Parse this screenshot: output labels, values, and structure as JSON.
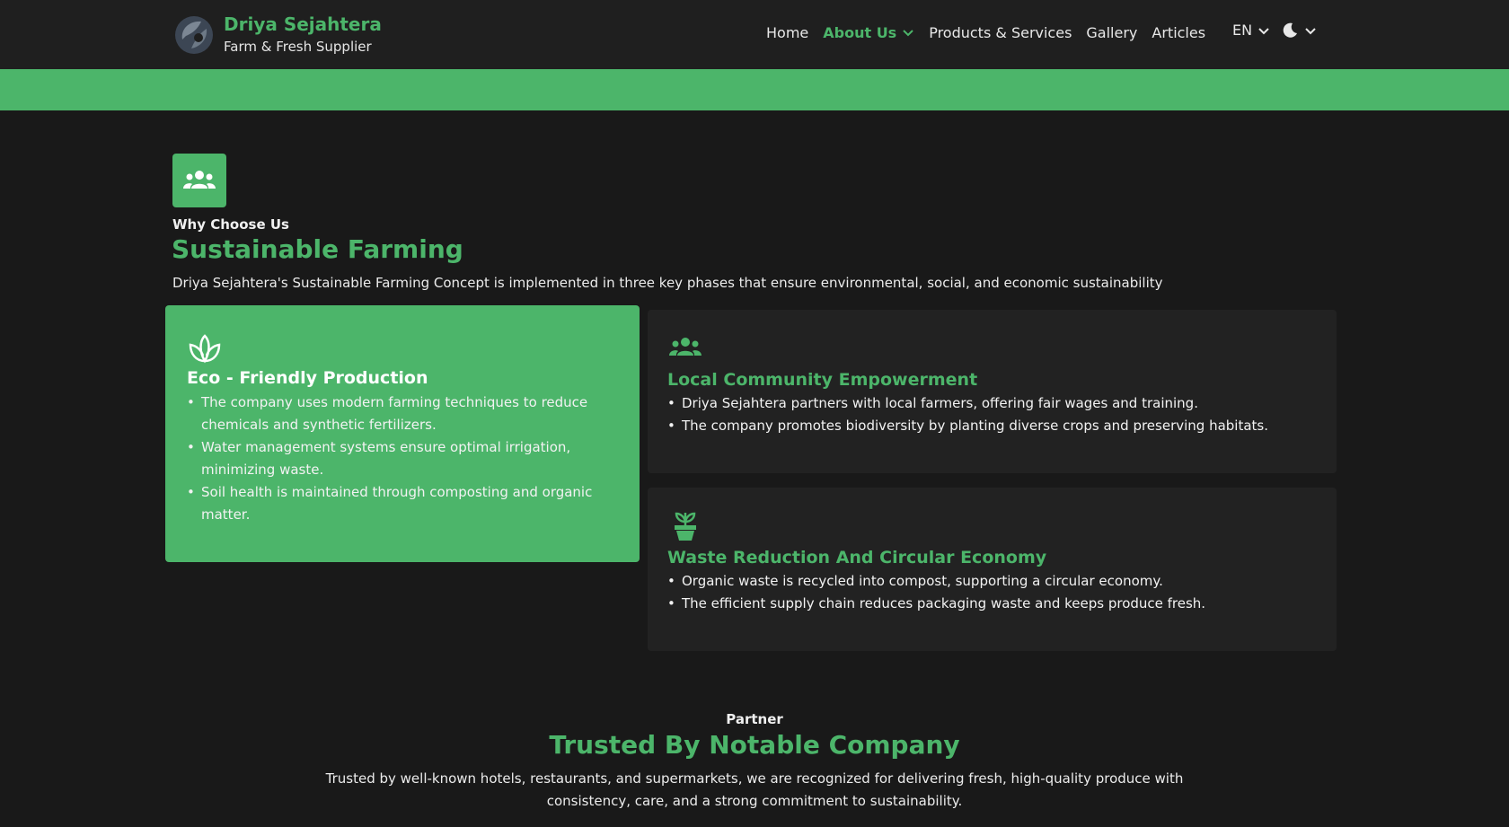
{
  "brand": {
    "name": "Driya Sejahtera",
    "tagline": "Farm & Fresh Supplier",
    "logo_icon": "leaf-globe-logo"
  },
  "nav": {
    "items": [
      {
        "label": "Home",
        "active": false
      },
      {
        "label": "About Us",
        "active": true,
        "has_dropdown": true
      },
      {
        "label": "Products & Services",
        "active": false
      },
      {
        "label": "Gallery",
        "active": false
      },
      {
        "label": "Articles",
        "active": false
      }
    ],
    "language": "EN",
    "theme_icon": "moon-icon"
  },
  "colors": {
    "accent": "#4cb56a",
    "background": "#191919",
    "card": "#222222",
    "navbar": "#1f1f1f"
  },
  "why": {
    "icon": "users-group-icon",
    "eyebrow": "Why Choose Us",
    "title": "Sustainable Farming",
    "description": "Driya Sejahtera's Sustainable Farming Concept is implemented in three key phases that ensure environmental, social, and economic sustainability",
    "cards": [
      {
        "icon": "lotus-leaf-icon",
        "title": "Eco - Friendly Production",
        "items": [
          "The company uses modern farming techniques to reduce chemicals and synthetic fertilizers.",
          "Water management systems ensure optimal irrigation, minimizing waste.",
          "Soil health is maintained through composting and organic matter."
        ]
      },
      {
        "icon": "users-group-icon",
        "title": "Local Community Empowerment",
        "items": [
          "Driya Sejahtera partners with local farmers, offering fair wages and training.",
          "The company promotes biodiversity by planting diverse crops and preserving habitats."
        ]
      },
      {
        "icon": "potted-plant-icon",
        "title": "Waste Reduction And Circular Economy",
        "items": [
          "Organic waste is recycled into compost, supporting a circular economy.",
          "The efficient supply chain reduces packaging waste and keeps produce fresh."
        ]
      }
    ]
  },
  "partner": {
    "eyebrow": "Partner",
    "title": "Trusted By Notable Company",
    "description": "Trusted by well-known hotels, restaurants, and supermarkets, we are recognized for delivering fresh, high-quality produce with consistency, care, and a strong commitment to sustainability."
  }
}
